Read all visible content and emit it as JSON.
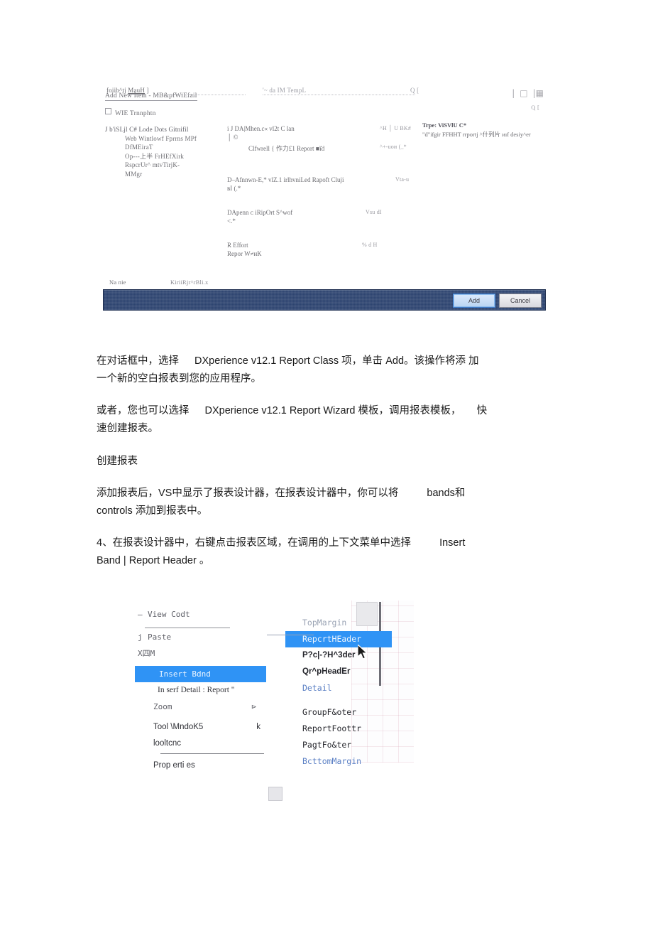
{
  "document": {
    "language": "zh-CN",
    "page_background": "#ffffff"
  },
  "dialog_screenshot": {
    "name": "add-new-item-dialog",
    "title": "Add New Item - MB&pfWiEfail",
    "subtitle": "WIE Trnnphtn",
    "window_buttons": [
      "minimize",
      "maximize",
      "close"
    ],
    "window_extra": "Q [",
    "search_row": {
      "search_label": "foiib^tj",
      "search_value": "MauH",
      "search_end": "]",
      "sort_label": "'~ da IM TempL",
      "sort_end": "Q ["
    },
    "left_tree": {
      "root": "J b'iSLjl C# Lode Dots Gitnifil",
      "children": [
        "Web Wintlowf Fprrns MPf",
        "DfMEiraT",
        "Op---上半 FrHEfXirk",
        "RspcrUr^ mtvTirjK-",
        "MMgr"
      ]
    },
    "middle_items": [
      {
        "label": "i J DA|Mhen.c« vl2t C lan",
        "meta": "^Η │ U BK#"
      },
      {
        "label": "│ ©",
        "meta": ""
      },
      {
        "label": "Clfwrell { 作力£1 Report ■ï̈d",
        "meta": "^+-uои (_*"
      },
      {
        "label": "D–Afnnwn-E,* vlZ.1 irlhvniLed Rapoft Cluji",
        "meta": "Vta-u"
      },
      {
        "label": "вІ (.*",
        "meta": ""
      },
      {
        "label": "DApenn ᴄ iRipOrt S^wof",
        "meta": "Vsu dI"
      },
      {
        "label": "<.*",
        "meta": ""
      },
      {
        "label": "R Effort",
        "meta": "% d H"
      },
      {
        "label": "Repor W≠иК",
        "meta": ""
      }
    ],
    "right_panel": {
      "type_line": "Trpe: ViSVlU C*",
      "description": "\"d\"ifgir FFHHT rrportj  ^什列片 иıf desiy^er"
    },
    "name_row": {
      "label": "Na nie",
      "value": "KiriiRjr^rBli.x"
    },
    "action_bar": {
      "background_color": "#2d4470",
      "add_label": "Add",
      "cancel_label": "Cancel"
    }
  },
  "body": {
    "paragraph_1": {
      "line_1_a": "在对话框中，选择",
      "line_1_b": "DXperience v12.1 Report Class",
      "line_1_c": "项，单击",
      "line_1_d": "Add",
      "line_1_e": "。该操作将添",
      "line_1_f": "加",
      "line_2": "一个新的空白报表到您的应用程序。"
    },
    "paragraph_2": {
      "line_1_a": "或者，您也可以选择",
      "line_1_b": "DXperience v12.1 Report Wizard",
      "line_1_c": "模板，调用报表模板，",
      "line_1_d": "快",
      "line_2": "速创建报表。"
    },
    "heading": "创建报表",
    "paragraph_3": {
      "line_1_a": "添加报表后，",
      "line_1_b": "VS",
      "line_1_c": "中显示了报表设计器，在报表设计器中，你可以将",
      "line_1_d": "bands",
      "line_1_e": "和",
      "line_2_a": "controls",
      "line_2_b": "添加到报表中。"
    },
    "paragraph_4": {
      "line_1_a": "4、在报表设计器中，右键点击报表区域，在调用的上下文菜单中选择",
      "line_1_b": "Insert",
      "line_2_a": "Band | Report Header",
      "line_2_b": "。"
    }
  },
  "menu_screenshot": {
    "name": "report-designer-context-menu",
    "context_menu": [
      {
        "label": "View Codt",
        "style": "mono",
        "prefix": "–",
        "selected": false
      },
      {
        "label": "Paste",
        "style": "mono",
        "prefix": "j",
        "selected": false
      },
      {
        "label": "X四M",
        "style": "mono",
        "prefix": "",
        "selected": false
      },
      {
        "label": "Insert Bdnd",
        "style": "mono",
        "prefix": "",
        "selected": true
      },
      {
        "label": "In serf Detail : Report \"",
        "style": "serif",
        "prefix": "",
        "selected": false
      },
      {
        "label": "Zoom",
        "style": "mono",
        "prefix": "",
        "selected": false,
        "submenu_arrow": "⊳"
      },
      {
        "label": "Tool \\MndoK5",
        "style": "sans",
        "prefix": "",
        "selected": false,
        "shortcut": "k"
      },
      {
        "label": "looltcnc",
        "style": "sans",
        "prefix": "",
        "selected": false
      },
      {
        "label": "Prop erti es",
        "style": "sans",
        "prefix": "",
        "selected": false
      }
    ],
    "submenu": {
      "title": "insert-band-submenu",
      "items": [
        {
          "label": "TopMargin",
          "state": "disabled",
          "selected": false
        },
        {
          "label": "RepcrtHEader",
          "state": "enabled",
          "selected": true
        },
        {
          "label": "P?c|-?H^3der",
          "state": "enabled",
          "selected": false
        },
        {
          "label": "Qr^pHeadEr",
          "state": "enabled",
          "selected": false
        },
        {
          "label": "Detail",
          "state": "disabled",
          "selected": false
        },
        {
          "label": "GroupF&oter",
          "state": "enabled",
          "selected": false
        },
        {
          "label": "ReportFoottr",
          "state": "enabled",
          "selected": false
        },
        {
          "label": "PagtFo&ter",
          "state": "enabled",
          "selected": false
        },
        {
          "label": "BcttomMargin",
          "state": "disabled",
          "selected": false
        }
      ]
    },
    "highlight_color": "#2f93f5"
  }
}
